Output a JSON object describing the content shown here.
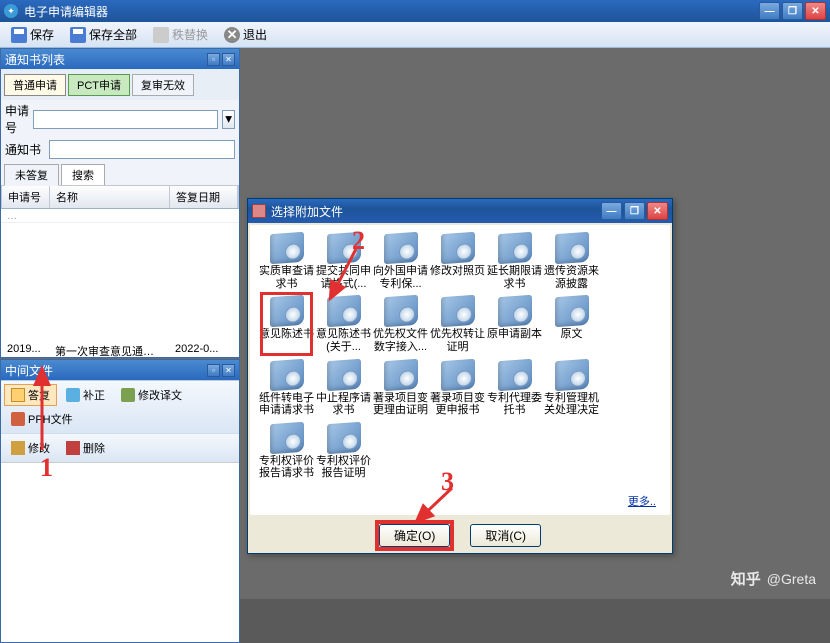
{
  "app": {
    "title": "电子申请编辑器"
  },
  "toolbar": {
    "save": "保存",
    "save_all": "保存全部",
    "replace": "秩替换",
    "exit": "退出"
  },
  "panel_list": {
    "title": "通知书列表",
    "tabs": {
      "normal": "普通申请",
      "pct": "PCT申请",
      "reexam": "复审无效"
    },
    "field_appno": "申请号",
    "field_notice": "通知书",
    "subtabs": {
      "unreplied": "未答复",
      "search": "搜索"
    },
    "cols": {
      "appno": "申请号",
      "name": "名称",
      "reply_date": "答复日期"
    },
    "row": {
      "appno": "2019...",
      "name": "第一次审查意见通知书",
      "date": "2022-0..."
    }
  },
  "panel_mid": {
    "title": "中间文件",
    "btns": {
      "reply": "答复",
      "correct": "补正",
      "translate": "修改译文",
      "ppt": "PPH文件",
      "edit": "修改",
      "delete": "删除"
    }
  },
  "dialog": {
    "title": "选择附加文件",
    "items": [
      "实质审查请求书",
      "提交共同申请格式(...",
      "向外国申请专利保...",
      "修改对照页",
      "延长期限请求书",
      "遗传资源来源披露",
      "意见陈述书",
      "意见陈述书(关于...",
      "优先权文件数字接入...",
      "优先权转让证明",
      "原申请副本",
      "原文",
      "纸件转电子申请请求书",
      "中止程序请求书",
      "著录项目变更理由证明",
      "著录项目变更申报书",
      "专利代理委托书",
      "专利管理机关处理决定",
      "专利权评价报告请求书",
      "专利权评价报告证明"
    ],
    "more": "更多..",
    "ok": "确定(O)",
    "cancel": "取消(C)"
  },
  "anno": {
    "n1": "1",
    "n2": "2",
    "n3": "3"
  },
  "watermark": {
    "site": "知乎",
    "author": "@Greta"
  }
}
